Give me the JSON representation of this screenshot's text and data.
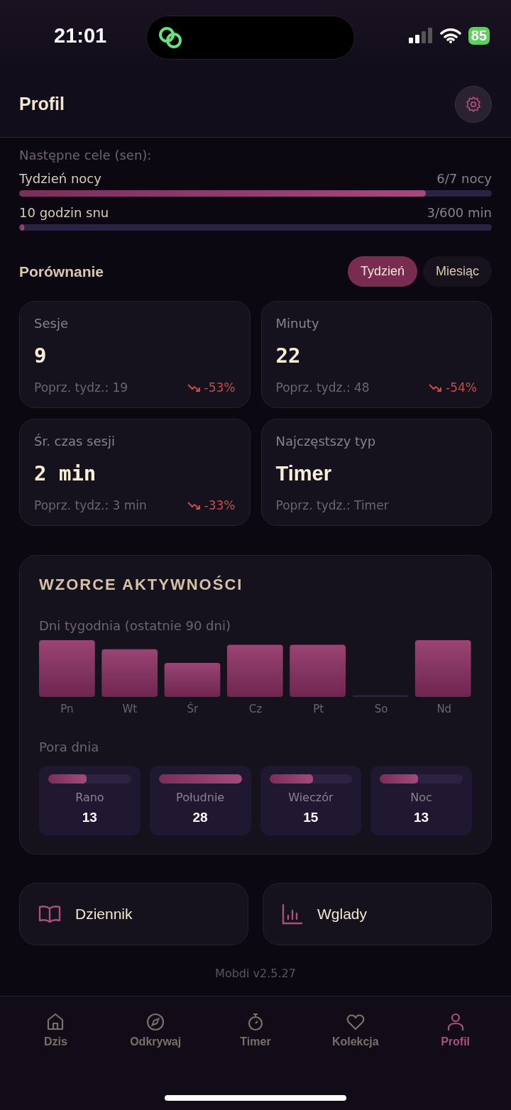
{
  "status_bar": {
    "time": "21:01",
    "battery": "85"
  },
  "header": {
    "title": "Profil"
  },
  "goals": {
    "label": "Następne cele (sen):",
    "items": [
      {
        "name": "Tydzień nocy",
        "reading": "6/7 nocy",
        "level": 0.86
      },
      {
        "name": "10 godzin snu",
        "reading": "3/600 min",
        "level": 0.01
      }
    ]
  },
  "comparison": {
    "title": "Porównanie",
    "periods": [
      {
        "label": "Tydzień",
        "selected": true
      },
      {
        "label": "Miesiąc",
        "selected": false
      }
    ],
    "cards": [
      {
        "label": "Sesje",
        "value": "9",
        "mono": true,
        "previous": "Poprz. tydz.: 19",
        "change": "-53%"
      },
      {
        "label": "Minuty",
        "value": "22",
        "mono": true,
        "previous": "Poprz. tydz.: 48",
        "change": "-54%"
      },
      {
        "label": "Śr. czas sesji",
        "value": "2 min",
        "mono": true,
        "previous": "Poprz. tydz.: 3 min",
        "change": "-33%"
      },
      {
        "label": "Najczęstszy typ",
        "value": "Timer",
        "mono": false,
        "previous": "Poprz. tydz.: Timer"
      }
    ]
  },
  "activity": {
    "title": "WZORCE AKTYWNOŚCI",
    "weekdays_label": "Dni tygodnia (ostatnie 90 dni)",
    "weekdays": [
      {
        "label": "Pn"
      },
      {
        "label": "Wt"
      },
      {
        "label": "Śr"
      },
      {
        "label": "Cz"
      },
      {
        "label": "Pt"
      },
      {
        "label": "So"
      },
      {
        "label": "Nd"
      }
    ],
    "time_of_day_label": "Pora dnia",
    "time_of_day": [
      {
        "label": "Rano",
        "count": "13",
        "level": 0.46
      },
      {
        "label": "Południe",
        "count": "28",
        "level": 1
      },
      {
        "label": "Wieczór",
        "count": "15",
        "level": 0.53
      },
      {
        "label": "Noc",
        "count": "13",
        "level": 0.46
      }
    ]
  },
  "actions": [
    {
      "kind": "journal",
      "label": "Dziennik"
    },
    {
      "kind": "insights",
      "label": "Wglady"
    }
  ],
  "version": "Mobdi v2.5.27",
  "tabs": [
    {
      "kind": "home",
      "label": "Dzis",
      "selected": false
    },
    {
      "kind": "compass",
      "label": "Odkrywaj",
      "selected": false
    },
    {
      "kind": "timer",
      "label": "Timer",
      "selected": false
    },
    {
      "kind": "heart",
      "label": "Kolekcja",
      "selected": false
    },
    {
      "kind": "person",
      "label": "Profil",
      "selected": true
    }
  ]
}
